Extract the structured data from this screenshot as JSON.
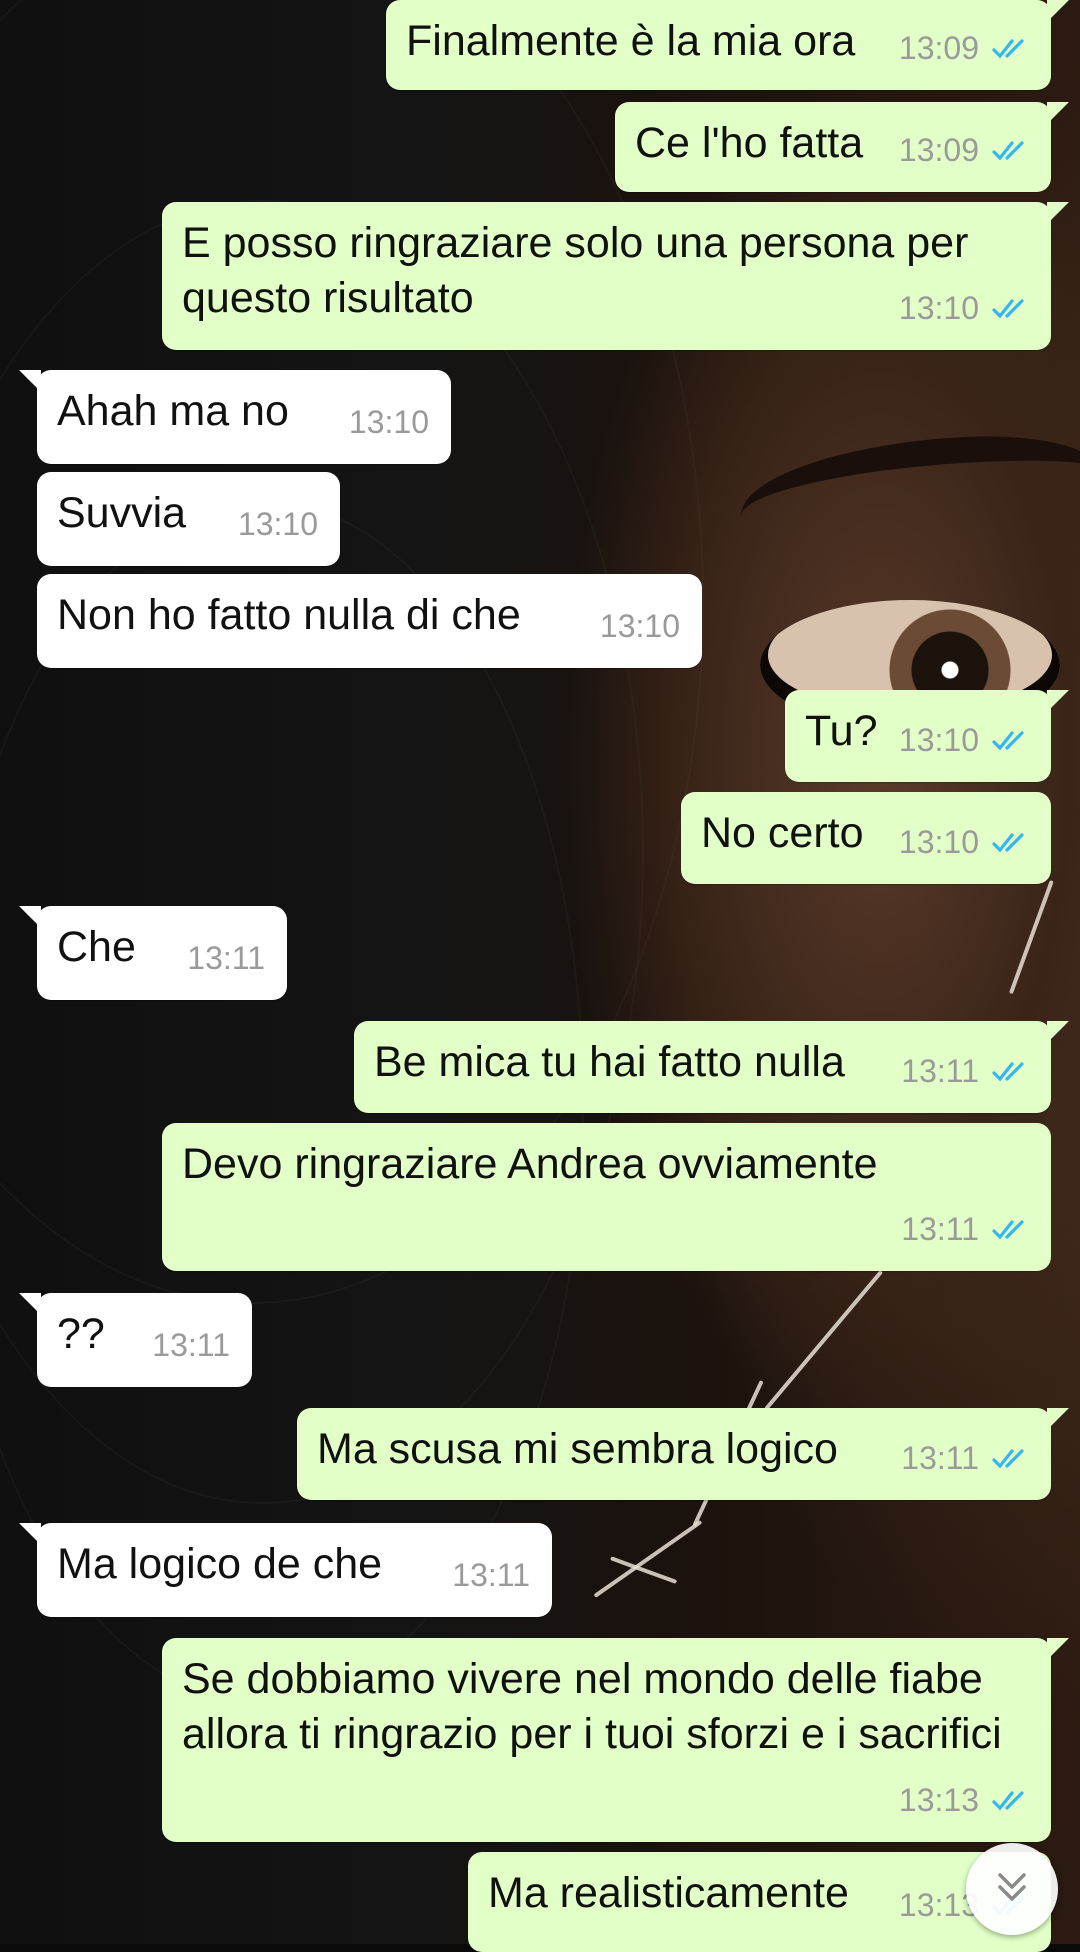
{
  "colors": {
    "outgoing_bubble": "#e1ffc7",
    "incoming_bubble": "#ffffff",
    "read_ticks": "#34b7f1",
    "timestamp": "#9a9a9a"
  },
  "messages": [
    {
      "dir": "out",
      "text": "Finalmente è la mia ora",
      "time": "13:09",
      "read": true
    },
    {
      "dir": "out",
      "text": "Ce l'ho fatta",
      "time": "13:09",
      "read": true
    },
    {
      "dir": "out",
      "text": "E posso ringraziare solo una persona per questo risultato",
      "time": "13:10",
      "read": true
    },
    {
      "dir": "in",
      "text": "Ahah ma no",
      "time": "13:10"
    },
    {
      "dir": "in",
      "text": "Suvvia",
      "time": "13:10"
    },
    {
      "dir": "in",
      "text": "Non ho fatto nulla di che",
      "time": "13:10"
    },
    {
      "dir": "out",
      "text": "Tu?",
      "time": "13:10",
      "read": true
    },
    {
      "dir": "out",
      "text": "No certo",
      "time": "13:10",
      "read": true
    },
    {
      "dir": "in",
      "text": "Che",
      "time": "13:11"
    },
    {
      "dir": "out",
      "text": "Be mica tu hai fatto nulla",
      "time": "13:11",
      "read": true
    },
    {
      "dir": "out",
      "text": "Devo ringraziare Andrea ovviamente",
      "time": "13:11",
      "read": true
    },
    {
      "dir": "in",
      "text": "??",
      "time": "13:11"
    },
    {
      "dir": "out",
      "text": "Ma scusa mi sembra logico",
      "time": "13:11",
      "read": true
    },
    {
      "dir": "in",
      "text": "Ma logico de che",
      "time": "13:11"
    },
    {
      "dir": "out",
      "text": "Se dobbiamo vivere nel mondo delle fiabe allora ti ringrazio per i tuoi sforzi e i sacrifici",
      "time": "13:13",
      "read": true
    },
    {
      "dir": "out",
      "text": "Ma realisticamente",
      "time": "13:13",
      "read": true
    }
  ],
  "scroll_button": {
    "icon": "double-chevron-down-icon"
  }
}
